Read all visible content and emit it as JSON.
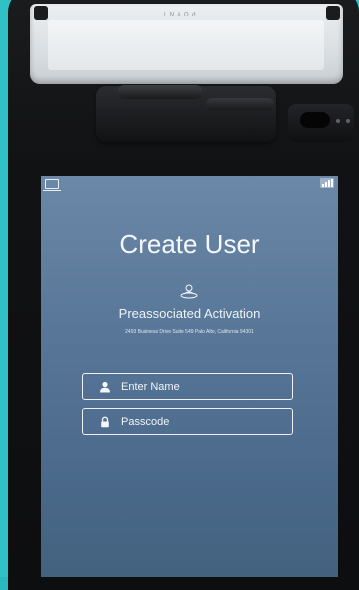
{
  "device": {
    "brand": "POYNT"
  },
  "screen": {
    "title": "Create User",
    "subtitle": "Preassociated Activation",
    "address": "2493 Business Drive Suite 549 Palo Alto, California 94301",
    "status_icons": [
      "tablet-icon",
      "signal-icon"
    ],
    "fields": {
      "name": {
        "placeholder": "Enter Name",
        "icon": "user-icon"
      },
      "passcode": {
        "placeholder": "Passcode",
        "icon": "lock-icon"
      }
    }
  },
  "colors": {
    "background": "#2bb8bf",
    "screen_top": "#6c88a8",
    "screen_bottom": "#42627f",
    "text": "#f4f7fb"
  }
}
